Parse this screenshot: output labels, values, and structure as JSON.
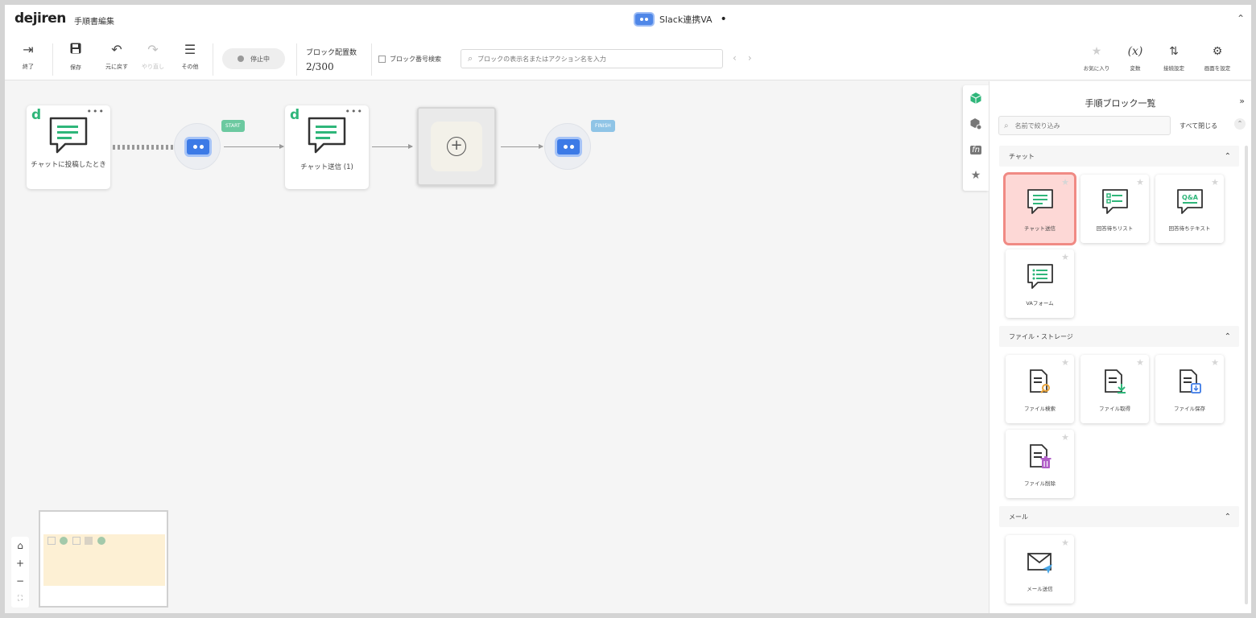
{
  "header": {
    "logo": "dejiren",
    "screen_name": "手順書編集",
    "title": "Slack連携VA",
    "unsaved_mark": "•",
    "collapse_icon": "double-chevron-up-icon"
  },
  "toolbar": {
    "exit": "終了",
    "save": "保存",
    "undo": "元に戻す",
    "redo": "やり直し",
    "other": "その他",
    "status": "停止中",
    "count_label": "ブロック配置数",
    "count_value": "2/300",
    "block_number_search": "ブロック番号検索",
    "search_placeholder": "ブロックの表示名またはアクション名を入力",
    "nav_prev": "‹",
    "nav_next": "›",
    "favorites": "お気に入り",
    "variables": "変数",
    "node_settings": "接続設定",
    "screen_settings": "画面を設定"
  },
  "canvas": {
    "trigger_card": "チャットに投稿したとき",
    "send_card": "チャット送信 (1)",
    "start_tag": "START",
    "finish_tag": "FINISH",
    "more": "•••",
    "zoom_controls": [
      "⌂",
      "+",
      "−",
      "⛶"
    ]
  },
  "panel": {
    "title": "手順ブロック一覧",
    "expand": "»",
    "filter_placeholder": "名前で絞り込み",
    "close_all": "すべて閉じる",
    "categories": [
      {
        "name": "チャット",
        "tiles": [
          {
            "label": "チャット送信",
            "icon": "chat-send-icon"
          },
          {
            "label": "回答待ちリスト",
            "icon": "chat-list-icon"
          },
          {
            "label": "回答待ちテキスト",
            "icon": "chat-qa-icon"
          },
          {
            "label": "VAフォーム",
            "icon": "chat-form-icon"
          }
        ]
      },
      {
        "name": "ファイル・ストレージ",
        "tiles": [
          {
            "label": "ファイル検索",
            "icon": "file-search-icon"
          },
          {
            "label": "ファイル取得",
            "icon": "file-download-icon"
          },
          {
            "label": "ファイル保存",
            "icon": "file-save-icon"
          },
          {
            "label": "ファイル削除",
            "icon": "file-delete-icon"
          }
        ]
      },
      {
        "name": "メール",
        "tiles": [
          {
            "label": "メール送信",
            "icon": "mail-send-icon"
          }
        ]
      }
    ]
  },
  "colors": {
    "accent_green": "#2fb67a",
    "bot_blue": "#3c7ae6",
    "selected_tile": "#fdd8d6",
    "selected_border": "#f08a84"
  }
}
